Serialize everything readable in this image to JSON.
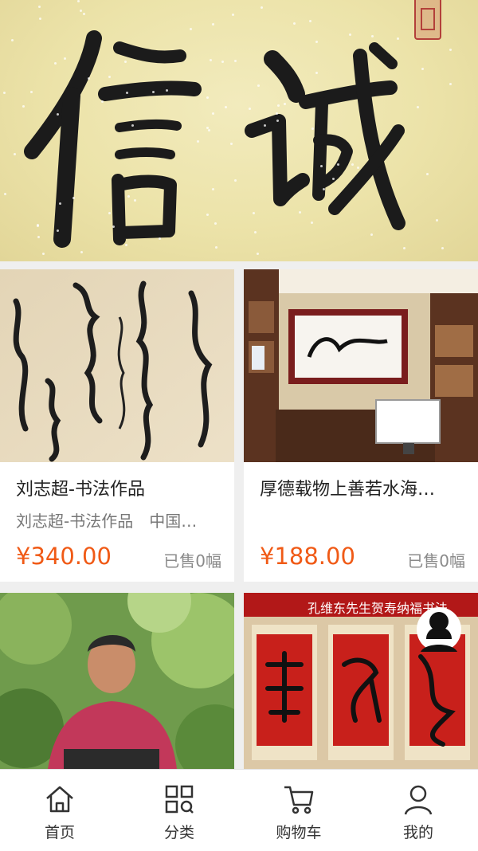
{
  "banner": {
    "calligraphy": "信 诚"
  },
  "products": [
    {
      "title": "刘志超-书法作品",
      "subtitle": "刘志超-书法作品　中国…",
      "price": "¥340.00",
      "sold": "已售0幅"
    },
    {
      "title": "厚德载物上善若水海…",
      "subtitle": "",
      "price": "¥188.00",
      "sold": "已售0幅"
    },
    {
      "title": "",
      "subtitle": "",
      "price": "",
      "sold": ""
    },
    {
      "banner_text": "孔维东先生贺寿纳福书法"
    }
  ],
  "tabbar": {
    "items": [
      {
        "label": "首页",
        "icon": "home-icon"
      },
      {
        "label": "分类",
        "icon": "category-icon"
      },
      {
        "label": "购物车",
        "icon": "cart-icon"
      },
      {
        "label": "我的",
        "icon": "user-icon"
      }
    ]
  },
  "colors": {
    "price": "#f05a16",
    "background": "#efefef",
    "banner_paper": "#ece3a9"
  }
}
